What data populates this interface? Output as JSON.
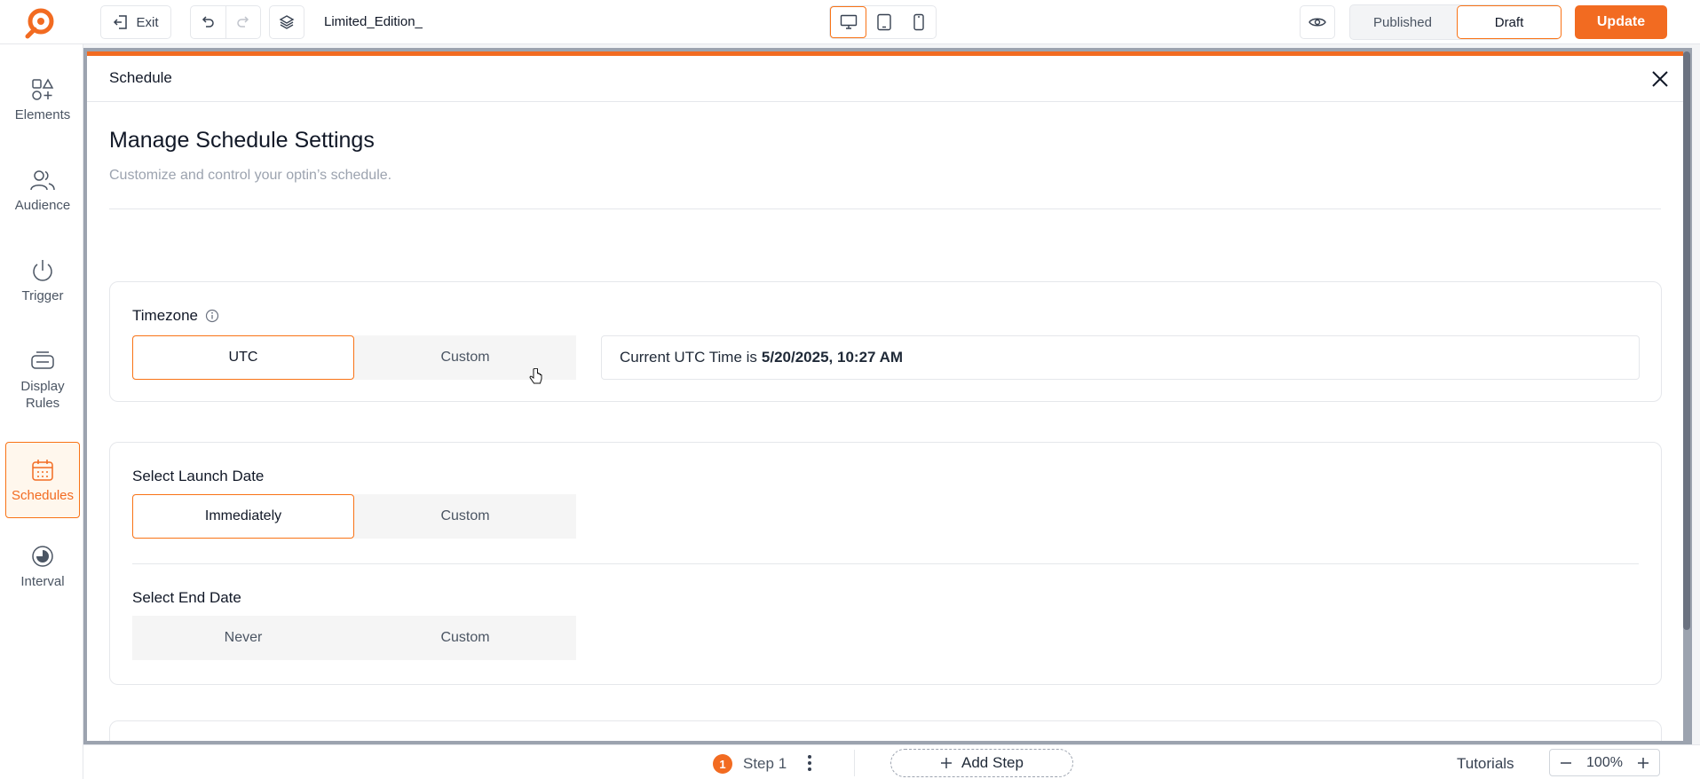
{
  "topbar": {
    "exit_label": "Exit",
    "campaign_name": "Limited_Edition_",
    "status_published": "Published",
    "status_draft": "Draft",
    "update_label": "Update"
  },
  "sidebar": {
    "items": [
      {
        "label": "Elements",
        "icon": "shapes-icon"
      },
      {
        "label": "Audience",
        "icon": "users-icon"
      },
      {
        "label": "Trigger",
        "icon": "power-icon"
      },
      {
        "label": "Display Rules",
        "icon": "rules-icon"
      },
      {
        "label": "Schedules",
        "icon": "calendar-icon",
        "active": true
      },
      {
        "label": "Interval",
        "icon": "interval-icon"
      }
    ]
  },
  "modal": {
    "title": "Schedule",
    "heading": "Manage Schedule Settings",
    "subheading": "Customize and control your optin’s schedule.",
    "timezone": {
      "label": "Timezone",
      "options": [
        "UTC",
        "Custom"
      ],
      "selected": "UTC",
      "current_time_prefix": "Current UTC Time is",
      "current_time_value": "5/20/2025, 10:27 AM"
    },
    "launch": {
      "label": "Select Launch Date",
      "options": [
        "Immediately",
        "Custom"
      ],
      "selected": "Immediately"
    },
    "end": {
      "label": "Select End Date",
      "options": [
        "Never",
        "Custom"
      ]
    }
  },
  "bottombar": {
    "step_number": "1",
    "step_label": "Step 1",
    "add_step_label": "Add Step",
    "tutorials_label": "Tutorials",
    "zoom_value": "100%"
  },
  "colors": {
    "accent": "#f26b21",
    "border": "#e5e7eb",
    "muted_text": "#9ca3af"
  }
}
